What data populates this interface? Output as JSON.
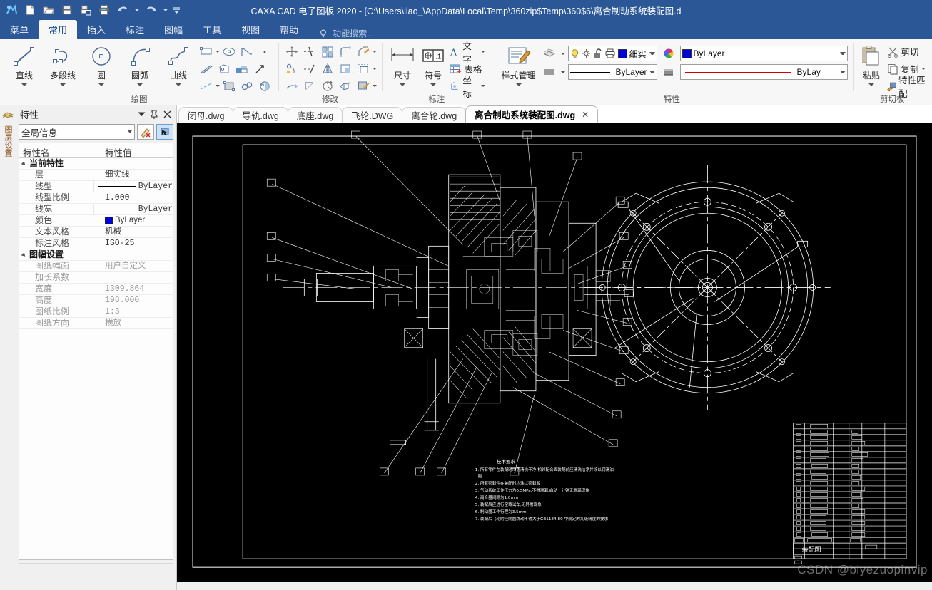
{
  "window": {
    "title": "CAXA CAD 电子图板 2020 - [C:\\Users\\liao_\\AppData\\Local\\Temp\\360zip$Temp\\360$6\\离合制动系统装配图.d"
  },
  "quick_access": {
    "icons": [
      "app-logo-icon",
      "new-file-icon",
      "open-folder-icon",
      "save-icon",
      "save-as-icon",
      "print-icon",
      "undo-icon",
      "undo-dropdown-icon",
      "redo-icon",
      "redo-dropdown-icon",
      "customize-qat-icon"
    ]
  },
  "ribbon_tabs": [
    {
      "label": "菜单",
      "active": false
    },
    {
      "label": "常用",
      "active": true
    },
    {
      "label": "插入",
      "active": false
    },
    {
      "label": "标注",
      "active": false
    },
    {
      "label": "图幅",
      "active": false
    },
    {
      "label": "工具",
      "active": false
    },
    {
      "label": "视图",
      "active": false
    },
    {
      "label": "帮助",
      "active": false
    }
  ],
  "search": {
    "placeholder": "功能搜索...",
    "icon": "lightbulb-icon"
  },
  "ribbon": {
    "draw": {
      "title": "绘图",
      "big_buttons": [
        {
          "label": "直线",
          "icon": "line-icon"
        },
        {
          "label": "多段线",
          "icon": "polyline-icon"
        },
        {
          "label": "圆",
          "icon": "circle-icon"
        },
        {
          "label": "圆弧",
          "icon": "arc-icon"
        },
        {
          "label": "曲线",
          "icon": "spline-icon"
        }
      ],
      "mini_icons": [
        [
          "rectangle-icon",
          "ellipse-icon",
          "parabola-icon",
          "point-icon"
        ],
        [
          "double-line-icon",
          "polygon-icon",
          "hole-icon",
          "arrow-icon"
        ],
        [
          "centerline-icon",
          "hatch-icon",
          "gear-icon",
          "local-enlarge-icon"
        ]
      ]
    },
    "modify": {
      "title": "修改",
      "mini_icons": [
        [
          "move-icon",
          "trim-icon",
          "array-icon",
          "corner-icon",
          "chamfer-icon"
        ],
        [
          "rotate-copy-icon",
          "extend-icon",
          "mirror-icon",
          "fillet-icon",
          "offset-icon"
        ],
        [
          "stretch-icon",
          "break-icon",
          "scale-icon",
          "explode-icon",
          "edit-hatch-icon"
        ]
      ]
    },
    "annotate": {
      "title": "标注",
      "big_buttons": [
        {
          "label": "尺寸",
          "icon": "dimension-icon"
        },
        {
          "label": "符号",
          "icon": "symbol-icon"
        }
      ],
      "text_buttons": [
        {
          "label": "文字",
          "icon": "text-icon",
          "dropdown": true
        },
        {
          "label": "表格",
          "icon": "table-icon",
          "dropdown": false
        },
        {
          "label": "坐标",
          "icon": "coordinate-icon",
          "dropdown": true
        }
      ]
    },
    "properties": {
      "title": "特性",
      "style_manager": {
        "label": "样式管理",
        "icon": "style-manager-icon"
      },
      "layer_control": {
        "icons": [
          "lightbulb-icon",
          "sun-icon",
          "unlock-icon",
          "printer-icon"
        ],
        "color": "#0000d8",
        "value": "细实"
      },
      "color_control": {
        "value": "ByLayer",
        "swatch": "#0000d8",
        "icon": "color-wheel-icon"
      },
      "linetype_control": {
        "value": "ByLayer",
        "icon": "linetype-icon"
      },
      "lineweight_control": {
        "value": "ByLay",
        "icon": "lineweight-icon",
        "color": "#d40000"
      }
    },
    "clipboard": {
      "title": "剪切板",
      "paste": {
        "label": "粘贴",
        "icon": "paste-icon"
      },
      "items": [
        {
          "label": "剪切",
          "icon": "cut-icon",
          "dropdown": false
        },
        {
          "label": "复制",
          "icon": "copy-icon",
          "dropdown": true
        },
        {
          "label": "特性匹配",
          "icon": "match-properties-icon",
          "dropdown": false
        }
      ]
    }
  },
  "side_dock": {
    "label": "图层设置"
  },
  "properties_panel": {
    "title": "特性",
    "header_icons": [
      "panel-dropdown-icon",
      "pin-icon",
      "close-icon"
    ],
    "selector": {
      "value": "全局信息"
    },
    "toolbar_buttons": [
      {
        "name": "clear-selection-button",
        "icon": "pencil-clear-icon"
      },
      {
        "name": "pick-selection-button",
        "icon": "pick-object-icon"
      }
    ],
    "columns": [
      "特性名",
      "特性值"
    ],
    "groups": [
      {
        "name": "当前特性",
        "rows": [
          {
            "key": "层",
            "value": "细实线",
            "kind": "text"
          },
          {
            "key": "线型",
            "value": "ByLayer",
            "kind": "linetype"
          },
          {
            "key": "线型比例",
            "value": "1.000",
            "kind": "mono"
          },
          {
            "key": "线宽",
            "value": "ByLayer",
            "kind": "lineweight"
          },
          {
            "key": "颜色",
            "value": "ByLayer",
            "kind": "color",
            "swatch": "#0000d8"
          },
          {
            "key": "文本风格",
            "value": "机械",
            "kind": "text"
          },
          {
            "key": "标注风格",
            "value": "ISO-25",
            "kind": "mono"
          }
        ]
      },
      {
        "name": "图幅设置",
        "dim": true,
        "rows": [
          {
            "key": "图纸幅面",
            "value": "用户自定义",
            "kind": "text"
          },
          {
            "key": "加长系数",
            "value": "",
            "kind": "text"
          },
          {
            "key": "宽度",
            "value": "1309.864",
            "kind": "mono"
          },
          {
            "key": "高度",
            "value": "198.000",
            "kind": "mono"
          },
          {
            "key": "图纸比例",
            "value": "1:3",
            "kind": "mono"
          },
          {
            "key": "图纸方向",
            "value": "横放",
            "kind": "text"
          }
        ]
      }
    ]
  },
  "document_tabs": [
    {
      "label": "闭母.dwg",
      "active": false
    },
    {
      "label": "导轨.dwg",
      "active": false
    },
    {
      "label": "底座.dwg",
      "active": false
    },
    {
      "label": "飞轮.DWG",
      "active": false
    },
    {
      "label": "离合轮.dwg",
      "active": false
    },
    {
      "label": "离合制动系统装配图.dwg",
      "active": true,
      "close": "✕"
    }
  ],
  "drawing": {
    "tech_req_title": "技术要求",
    "tech_req_lines": [
      "1. 所有零件在装配时均需清洗干净,相邻配合面装配前应清洗洁净并涂以润滑油",
      "   脂",
      "2. 所有密封件在装配时均涂以密封胶",
      "3. 气动系统工作压力为0.5MPa,不得泄漏,启动一分钟无泄漏现象",
      "4. 离合器间隙为1.0mm",
      "5. 装配后应进行空载试车,无异常现象",
      "6. 制动器工作行程为3.5mm",
      "7. 装配后飞轮的径向圆跳动不得大于GB1184-80 中规定的九级精度的要求"
    ],
    "title_block_label": "装配图",
    "watermark": "CSDN @biyezuopinvip"
  }
}
